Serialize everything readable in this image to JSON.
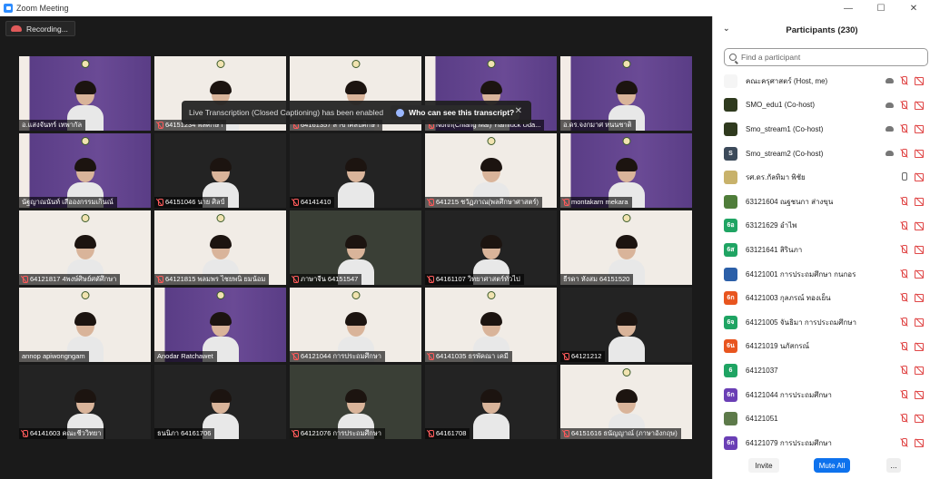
{
  "window": {
    "title": "Zoom Meeting",
    "min_glyph": "—",
    "max_glyph": "☐",
    "close_glyph": "✕"
  },
  "recording": {
    "label": "Recording..."
  },
  "toast": {
    "message": "Live Transcription (Closed Captioning) has been enabled",
    "action": "Who can see this transcript?",
    "close_glyph": "✕"
  },
  "tiles": [
    {
      "name": "อ.แสงจันทร์ เทพากัล",
      "muted": false,
      "bg": "purple"
    },
    {
      "name": "64151234 พลศึกษา",
      "muted": true,
      "bg": "light"
    },
    {
      "name": "64161357 สาขาศิลปศึกษา",
      "muted": true,
      "bg": "light"
    },
    {
      "name": "North(Chiang Mai) Yiamluck Uda...",
      "muted": true,
      "bg": "purple"
    },
    {
      "name": "อ.ดร.จงกมาศ หนนชาติ",
      "muted": false,
      "bg": "purple"
    },
    {
      "name": "นัฐญาณนันท์ เสือองกรรมเกินณ์",
      "muted": false,
      "bg": "purple"
    },
    {
      "name": "64151046 นาย ศิลป์",
      "muted": true,
      "bg": "dark"
    },
    {
      "name": "64141410",
      "muted": true,
      "bg": "dark"
    },
    {
      "name": "641215 ชวัฏภาณ(พลศึกษาศาสตร์)",
      "muted": true,
      "bg": "light"
    },
    {
      "name": "montakarn mekara",
      "muted": true,
      "bg": "purple"
    },
    {
      "name": "64121817 4พงษ์ศิษย์ศตัศึกษา",
      "muted": true,
      "bg": "light"
    },
    {
      "name": "64121815 พลมพร ไชยพนิ ยมน้อม",
      "muted": true,
      "bg": "light"
    },
    {
      "name": "ภาษาจีน 64151547",
      "muted": true,
      "bg": "room"
    },
    {
      "name": "64161107 วิทยาศาสตร์ทั่วไป",
      "muted": true,
      "bg": "dark"
    },
    {
      "name": "ธีรดา หังสม 64151520",
      "muted": false,
      "bg": "light"
    },
    {
      "name": "annop apiwongngam",
      "muted": false,
      "bg": "light"
    },
    {
      "name": "Anodar Ratchawet",
      "muted": false,
      "bg": "purple"
    },
    {
      "name": "64121044 การประถมศึกษา",
      "muted": true,
      "bg": "light"
    },
    {
      "name": "64141035 ธรพัคณา เคมี",
      "muted": true,
      "bg": "light"
    },
    {
      "name": "64121212",
      "muted": true,
      "bg": "dark"
    },
    {
      "name": "64141603 คณะชีววิทยา",
      "muted": true,
      "bg": "dark"
    },
    {
      "name": "ธนนิภา 64161706",
      "muted": false,
      "bg": "dark"
    },
    {
      "name": "64121076 การประถมศึกษา",
      "muted": true,
      "bg": "room"
    },
    {
      "name": "64161708",
      "muted": true,
      "bg": "dark"
    },
    {
      "name": "64151616 ธนัญญาณ์ (ภาษาอังกฤษ)",
      "muted": true,
      "bg": "light"
    }
  ],
  "panel": {
    "title": "Participants (230)",
    "search_placeholder": "Find a participant",
    "invite": "Invite",
    "mute_all": "Mute All",
    "more": "...",
    "participants": [
      {
        "name": "คณะครุศาสตร์ (Host, me)",
        "avatar": "",
        "avcolor": "#f5f5f5",
        "rec": true,
        "mic": "off",
        "cam": true
      },
      {
        "name": "SMO_edu1 (Co-host)",
        "avatar": "",
        "avcolor": "#2f3a1e",
        "rec": true,
        "mic": "off",
        "cam": true
      },
      {
        "name": "Smo_stream1 (Co-host)",
        "avatar": "",
        "avcolor": "#2f3a1e",
        "rec": true,
        "mic": "off",
        "cam": true
      },
      {
        "name": "Smo_stream2 (Co-host)",
        "avatar": "S",
        "avcolor": "#3c4a5a",
        "rec": true,
        "mic": "off",
        "cam": true
      },
      {
        "name": "รศ.ดร.กัลทิมา พิชัย",
        "avatar": "",
        "avcolor": "#c8b26b",
        "rec": false,
        "mic": "on",
        "cam": true
      },
      {
        "name": "63121604 ณฐชนกา ส่างขุน",
        "avatar": "",
        "avcolor": "#4f7d3a",
        "rec": false,
        "mic": "off",
        "cam": true
      },
      {
        "name": "63121629 อำไพ",
        "avatar": "6อ",
        "avcolor": "#1fa463",
        "rec": false,
        "mic": "off",
        "cam": true
      },
      {
        "name": "63121641 สิรินภา",
        "avatar": "6ส",
        "avcolor": "#1fa463",
        "rec": false,
        "mic": "off",
        "cam": true
      },
      {
        "name": "64121001 การประถมศึกษา กนกอร",
        "avatar": "",
        "avcolor": "#2b5fa8",
        "rec": false,
        "mic": "off",
        "cam": true
      },
      {
        "name": "64121003 กุลภรณ์ ทองเย็น",
        "avatar": "6ก",
        "avcolor": "#e8551f",
        "rec": false,
        "mic": "off",
        "cam": true
      },
      {
        "name": "64121005 จันธิมา การประถมศึกษา",
        "avatar": "6จ",
        "avcolor": "#1fa463",
        "rec": false,
        "mic": "off",
        "cam": true
      },
      {
        "name": "64121019 นภัสกรณ์",
        "avatar": "6น",
        "avcolor": "#e8551f",
        "rec": false,
        "mic": "off",
        "cam": true
      },
      {
        "name": "64121037",
        "avatar": "6",
        "avcolor": "#1fa463",
        "rec": false,
        "mic": "off",
        "cam": true
      },
      {
        "name": "64121044 การประถมศึกษา",
        "avatar": "6ก",
        "avcolor": "#6a3fb5",
        "rec": false,
        "mic": "off",
        "cam": true
      },
      {
        "name": "64121051",
        "avatar": "",
        "avcolor": "#5d7a4a",
        "rec": false,
        "mic": "off",
        "cam": true
      },
      {
        "name": "64121079 การประถมศึกษา",
        "avatar": "6ก",
        "avcolor": "#6a3fb5",
        "rec": false,
        "mic": "off",
        "cam": true
      }
    ]
  }
}
